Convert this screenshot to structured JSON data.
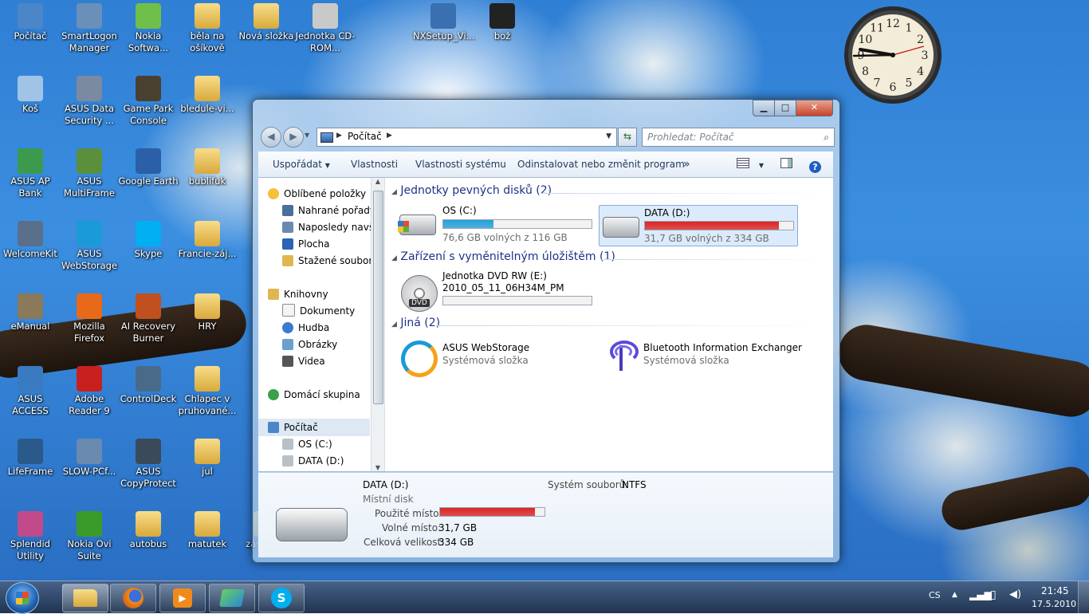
{
  "desktop": {
    "icons": [
      {
        "label": "Počítač",
        "col": 0,
        "row": 0,
        "color": "#4a86c8"
      },
      {
        "label": "SmartLogon Manager",
        "col": 1,
        "row": 0,
        "color": "#6a8fb8"
      },
      {
        "label": "Nokia Softwa...",
        "col": 2,
        "row": 0,
        "color": "#6fbf4a"
      },
      {
        "label": "běla na ošíkově",
        "col": 3,
        "row": 0,
        "folder": true
      },
      {
        "label": "Nová složka",
        "col": 4,
        "row": 0,
        "folder": true
      },
      {
        "label": "Jednotka CD-ROM...",
        "col": 5,
        "row": 0,
        "color": "#c9c9c9"
      },
      {
        "label": "NXSetup_Vi...",
        "col": 7,
        "row": 0,
        "color": "#3a6fb0"
      },
      {
        "label": "bož",
        "col": 8,
        "row": 0,
        "color": "#222"
      },
      {
        "label": "Koš",
        "col": 0,
        "row": 1,
        "color": "#9fc4e6"
      },
      {
        "label": "ASUS Data Security ...",
        "col": 1,
        "row": 1,
        "color": "#7a8aa0"
      },
      {
        "label": "Game Park Console",
        "col": 2,
        "row": 1,
        "color": "#4a4030"
      },
      {
        "label": "bledule-vi...",
        "col": 3,
        "row": 1,
        "folder": true
      },
      {
        "label": "ASUS AP Bank",
        "col": 0,
        "row": 2,
        "color": "#3b9a4e"
      },
      {
        "label": "ASUS MultiFrame",
        "col": 1,
        "row": 2,
        "color": "#5a8f3c"
      },
      {
        "label": "Google Earth",
        "col": 2,
        "row": 2,
        "color": "#2b5fa8"
      },
      {
        "label": "bublifuk",
        "col": 3,
        "row": 2,
        "folder": true
      },
      {
        "label": "WelcomeKit",
        "col": 0,
        "row": 3,
        "color": "#5a6f8a"
      },
      {
        "label": "ASUS WebStorage",
        "col": 1,
        "row": 3,
        "color": "#1a9ad6"
      },
      {
        "label": "Skype",
        "col": 2,
        "row": 3,
        "color": "#00aff0"
      },
      {
        "label": "Francie-záj...",
        "col": 3,
        "row": 3,
        "folder": true
      },
      {
        "label": "eManual",
        "col": 0,
        "row": 4,
        "color": "#8a7a5a"
      },
      {
        "label": "Mozilla Firefox",
        "col": 1,
        "row": 4,
        "color": "#e66a1a"
      },
      {
        "label": "AI Recovery Burner",
        "col": 2,
        "row": 4,
        "color": "#c05020"
      },
      {
        "label": "HRY",
        "col": 3,
        "row": 4,
        "folder": true
      },
      {
        "label": "ASUS ACCESS",
        "col": 0,
        "row": 5,
        "color": "#3a7ac0"
      },
      {
        "label": "Adobe Reader 9",
        "col": 1,
        "row": 5,
        "color": "#c8201e"
      },
      {
        "label": "ControlDeck",
        "col": 2,
        "row": 5,
        "color": "#4a6a8a"
      },
      {
        "label": "Chlapec v pruhované...",
        "col": 3,
        "row": 5,
        "folder": true
      },
      {
        "label": "LifeFrame",
        "col": 0,
        "row": 6,
        "color": "#2a5a8a"
      },
      {
        "label": "SLOW-PCf...",
        "col": 1,
        "row": 6,
        "color": "#6a8ab0"
      },
      {
        "label": "ASUS CopyProtect",
        "col": 2,
        "row": 6,
        "color": "#3a4a5a"
      },
      {
        "label": "jul",
        "col": 3,
        "row": 6,
        "folder": true
      },
      {
        "label": "Splendid Utility",
        "col": 0,
        "row": 7,
        "color": "#c04a8a"
      },
      {
        "label": "Nokia Ovi Suite",
        "col": 1,
        "row": 7,
        "color": "#3a9a2a"
      },
      {
        "label": "autobus",
        "col": 2,
        "row": 7,
        "folder": true
      },
      {
        "label": "matutek",
        "col": 3,
        "row": 7,
        "folder": true
      },
      {
        "label": "zástupce",
        "col": 4,
        "row": 7,
        "folder": true
      }
    ]
  },
  "explorer": {
    "address": {
      "crumb": "Počítač"
    },
    "search": {
      "placeholder": "Prohledat: Počítač"
    },
    "toolbar": {
      "organize": "Uspořádat",
      "properties": "Vlastnosti",
      "system_properties": "Vlastnosti systému",
      "uninstall": "Odinstalovat nebo změnit program",
      "more": "»"
    },
    "nav": {
      "favorites": "Oblíbené položky",
      "recorded_tv": "Nahrané pořady",
      "recent": "Naposledy navští",
      "desktop": "Plocha",
      "downloads": "Stažené soubory",
      "libraries": "Knihovny",
      "documents": "Dokumenty",
      "music": "Hudba",
      "pictures": "Obrázky",
      "videos": "Videa",
      "homegroup": "Domácí skupina",
      "computer": "Počítač",
      "drive_c": "OS (C:)",
      "drive_d": "DATA (D:)"
    },
    "groups": {
      "hdd": "Jednotky pevných disků (2)",
      "removable": "Zařízení s vyměnitelným úložištěm (1)",
      "other": "Jiná (2)"
    },
    "items": {
      "c": {
        "name": "OS (C:)",
        "free": "76,6 GB volných z 116 GB",
        "used_fraction": 0.34
      },
      "d": {
        "name": "DATA (D:)",
        "free": "31,7 GB volných z 334 GB",
        "used_fraction": 0.905
      },
      "dvd": {
        "name": "Jednotka DVD RW (E:)",
        "label": "2010_05_11_06H34M_PM",
        "badge": "DVD"
      },
      "webstorage": {
        "name": "ASUS WebStorage",
        "type": "Systémová složka"
      },
      "bluetooth": {
        "name": "Bluetooth Information Exchanger",
        "type": "Systémová složka"
      }
    },
    "details": {
      "name": "DATA (D:)",
      "type": "Místní disk",
      "used_label": "Použité místo:",
      "used_fraction": 0.905,
      "free_label": "Volné místo:",
      "free_value": "31,7 GB",
      "total_label": "Celková velikost:",
      "total_value": "334 GB",
      "fs_label": "Systém souborů:",
      "fs_value": "NTFS"
    },
    "caption": {
      "minimize": "▁",
      "maximize": "□",
      "close": "✕"
    }
  },
  "clock": {
    "numerals": [
      "12",
      "1",
      "2",
      "3",
      "4",
      "5",
      "6",
      "7",
      "8",
      "9",
      "10",
      "11"
    ]
  },
  "taskbar": {
    "lang": "CS",
    "time": "21:45",
    "date": "17.5.2010",
    "apps": [
      {
        "name": "explorer"
      },
      {
        "name": "firefox"
      },
      {
        "name": "media"
      },
      {
        "name": "messenger"
      },
      {
        "name": "skype"
      }
    ]
  },
  "colors": {
    "accent": "#1e3287",
    "bar_blue": "#26a0da",
    "bar_red": "#da2626"
  }
}
